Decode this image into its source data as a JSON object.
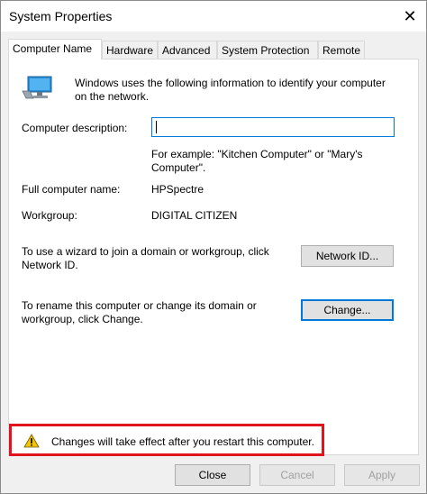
{
  "window": {
    "title": "System Properties",
    "close_glyph": "✕"
  },
  "tabs": [
    {
      "label": "Computer Name",
      "active": true
    },
    {
      "label": "Hardware",
      "active": false
    },
    {
      "label": "Advanced",
      "active": false
    },
    {
      "label": "System Protection",
      "active": false
    },
    {
      "label": "Remote",
      "active": false
    }
  ],
  "intro": {
    "line1": "Windows uses the following information to identify your computer",
    "line2": "on the network.",
    "icon": "computer-icon"
  },
  "description": {
    "label": "Computer description:",
    "value": "",
    "example_line1": "For example: \"Kitchen Computer\" or \"Mary's",
    "example_line2": "Computer\"."
  },
  "full_name": {
    "label": "Full computer name:",
    "value": "HPSpectre"
  },
  "workgroup": {
    "label": "Workgroup:",
    "value": "DIGITAL CITIZEN"
  },
  "network_id": {
    "text_line1": "To use a wizard to join a domain or workgroup, click",
    "text_line2": "Network ID.",
    "button_label": "Network ID..."
  },
  "rename": {
    "text_line1": "To rename this computer or change its domain or",
    "text_line2": "workgroup, click Change.",
    "button_label": "Change..."
  },
  "notice": {
    "text": "Changes will take effect after you restart this computer.",
    "icon": "warning-icon",
    "highlight_color": "#e0141e"
  },
  "footer": {
    "close_label": "Close",
    "cancel_label": "Cancel",
    "apply_label": "Apply"
  }
}
